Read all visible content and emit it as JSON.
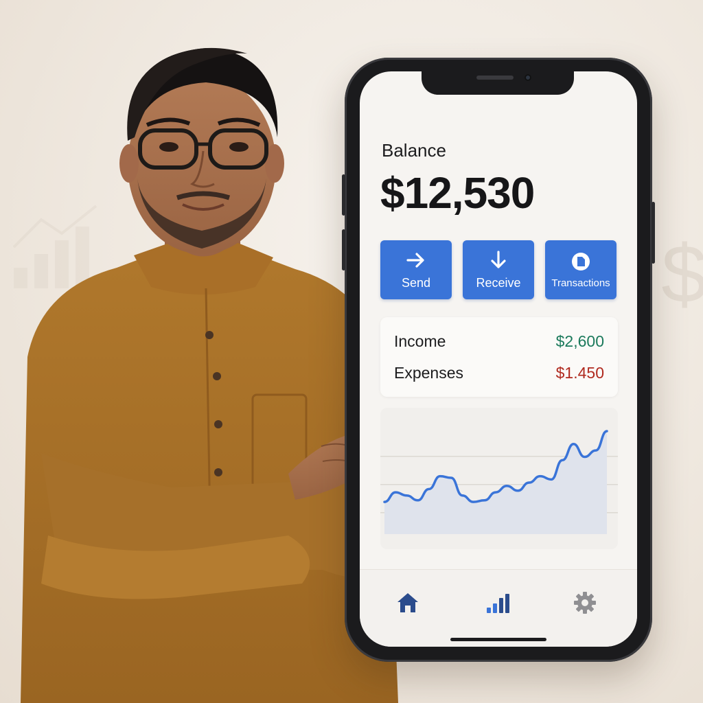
{
  "balance": {
    "label": "Balance",
    "value": "$12,530"
  },
  "actions": [
    {
      "label": "Send",
      "icon": "arrow-right-icon"
    },
    {
      "label": "Receive",
      "icon": "arrow-down-icon"
    },
    {
      "label": "Transactions",
      "icon": "clock-document-icon"
    }
  ],
  "summary": {
    "income_label": "Income",
    "income_value": "$2,600",
    "expenses_label": "Expenses",
    "expenses_value": "$1.450"
  },
  "chart_data": {
    "type": "area",
    "x": [
      0,
      1,
      2,
      3,
      4,
      5,
      6,
      7,
      8,
      9,
      10,
      11,
      12,
      13,
      14,
      15,
      16,
      17,
      18,
      19,
      20
    ],
    "series": [
      {
        "values": [
          2.0,
          2.6,
          2.4,
          2.1,
          2.8,
          3.6,
          3.5,
          2.4,
          2.0,
          2.1,
          2.6,
          3.0,
          2.7,
          3.2,
          3.6,
          3.4,
          4.6,
          5.6,
          4.8,
          5.2,
          6.4
        ]
      }
    ],
    "grid": true,
    "colors": {
      "line": "#3a74d8",
      "fill": "#dfe3ec"
    }
  },
  "tabbar": [
    {
      "icon": "home-icon",
      "active": true
    },
    {
      "icon": "bar-chart-icon",
      "active": false
    },
    {
      "icon": "gear-icon",
      "active": false
    }
  ],
  "colors": {
    "accent": "#3a74d8",
    "income": "#1c7a5c",
    "expense": "#b02a1f",
    "nav_icon": "#2b4c8c"
  }
}
